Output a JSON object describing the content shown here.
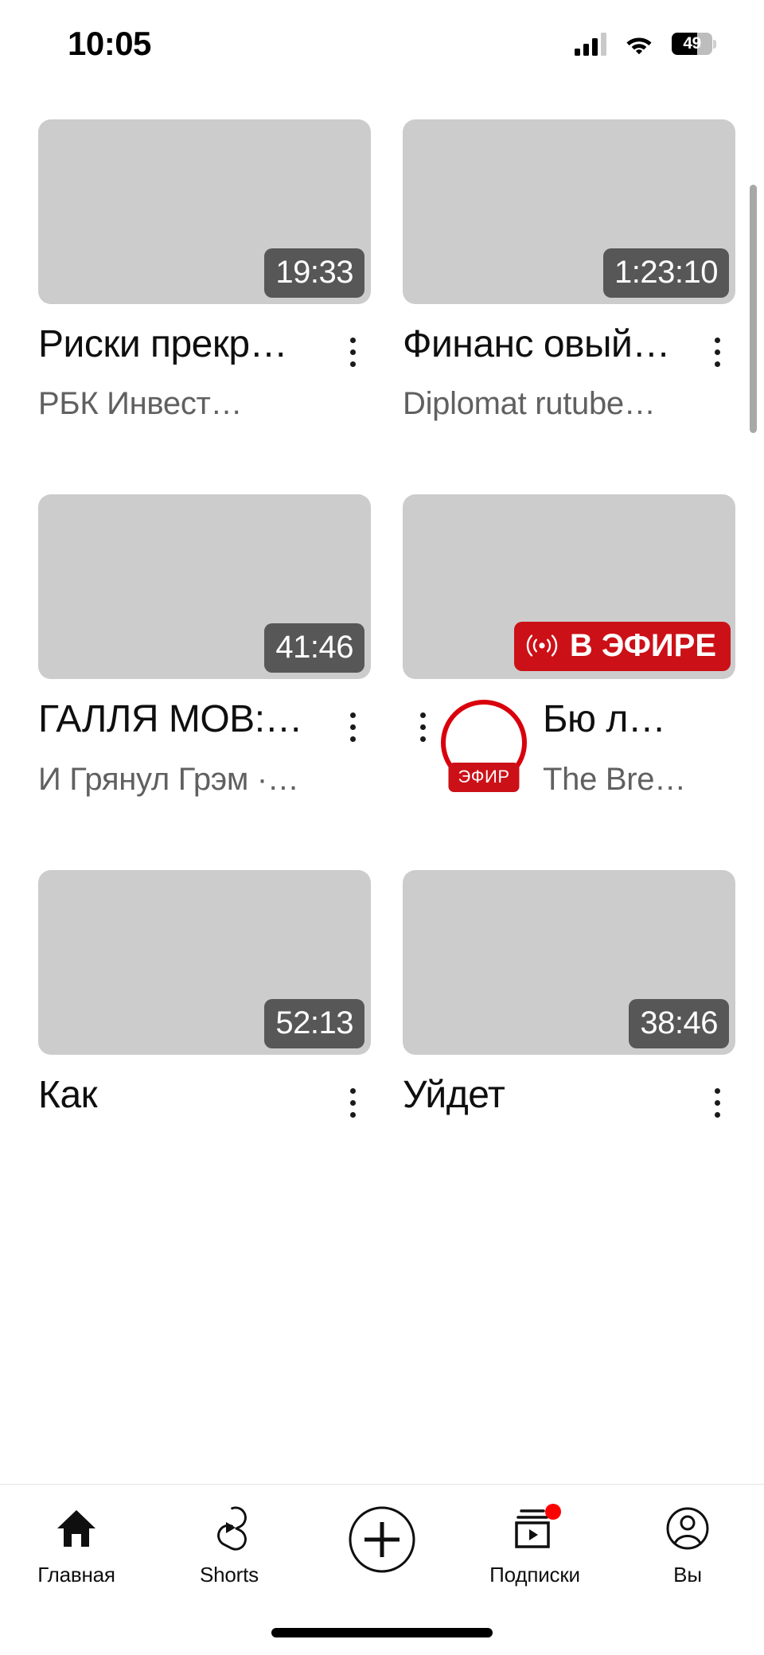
{
  "status_bar": {
    "time": "10:05",
    "battery_percent": "49",
    "icons": {
      "cellular": "signal-bars-icon",
      "wifi": "wifi-icon",
      "battery": "battery-icon"
    }
  },
  "colors": {
    "live_red": "#cc1017",
    "ring_red": "#d9000d",
    "notification_red": "#ff0000",
    "thumbnail_placeholder": "#cccccc",
    "duration_badge": "#575757",
    "primary_text": "#0f0f0f",
    "secondary_text": "#606060"
  },
  "feed": {
    "videos": [
      {
        "id": "video-1",
        "duration": "19:33",
        "is_live": false,
        "title": "Риски прекр…",
        "channel": "РБК Инвест…",
        "has_avatar": false,
        "menu": "more-options"
      },
      {
        "id": "video-2",
        "duration": "1:23:10",
        "is_live": false,
        "title": "Финанс овый…",
        "channel": "Diplomat rutube…",
        "has_avatar": false,
        "menu": "more-options"
      },
      {
        "id": "video-3",
        "duration": "41:46",
        "is_live": false,
        "title": "ГАЛЛЯ МОВ:…",
        "channel": "И Грянул Грэм ·…",
        "has_avatar": false,
        "menu": "more-options"
      },
      {
        "id": "video-4",
        "duration": "",
        "is_live": true,
        "live_label": "В ЭФИРЕ",
        "avatar_tag": "ЭФИР",
        "title": "Бю л…",
        "channel": "The Bre…",
        "has_avatar": true,
        "menu": "more-options"
      },
      {
        "id": "video-5",
        "duration": "52:13",
        "is_live": false,
        "title": "Как",
        "channel": "",
        "has_avatar": false,
        "menu": "more-options"
      },
      {
        "id": "video-6",
        "duration": "38:46",
        "is_live": false,
        "title": "Уйдет",
        "channel": "",
        "has_avatar": false,
        "menu": "more-options"
      }
    ]
  },
  "bottom_nav": {
    "items": [
      {
        "label": "Главная",
        "icon": "home-icon",
        "active": true,
        "badge": false
      },
      {
        "label": "Shorts",
        "icon": "shorts-icon",
        "active": false,
        "badge": false
      },
      {
        "label": "",
        "icon": "plus-circle-icon",
        "active": false,
        "badge": false
      },
      {
        "label": "Подписки",
        "icon": "subscriptions-icon",
        "active": false,
        "badge": true
      },
      {
        "label": "Вы",
        "icon": "account-icon",
        "active": false,
        "badge": false
      }
    ]
  }
}
